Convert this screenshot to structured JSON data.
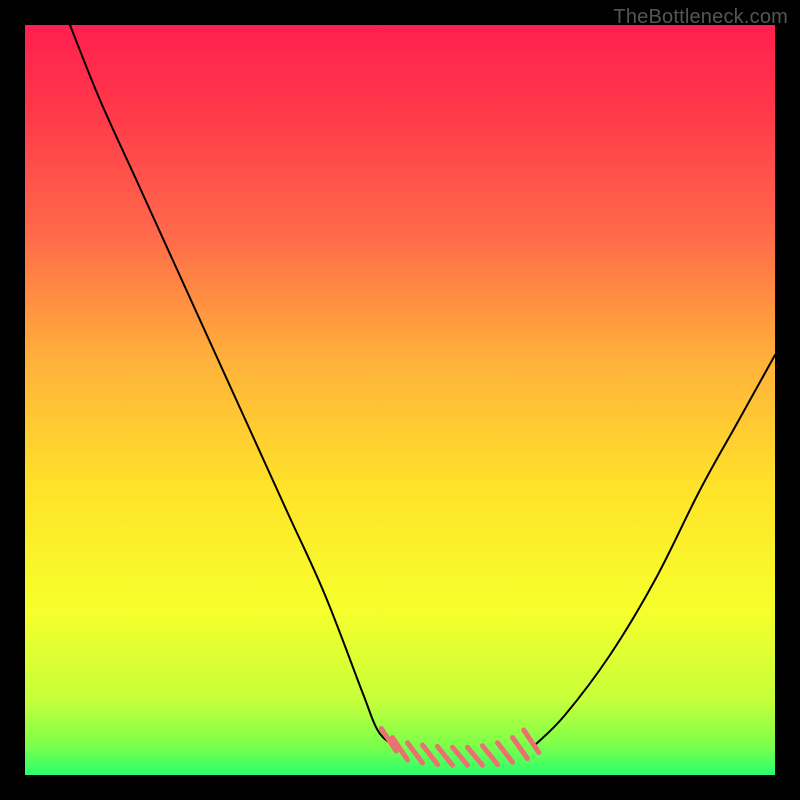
{
  "watermark": "TheBottleneck.com",
  "chart_data": {
    "type": "line",
    "title": "",
    "xlabel": "",
    "ylabel": "",
    "xlim": [
      0,
      100
    ],
    "ylim": [
      0,
      100
    ],
    "grid": false,
    "legend": false,
    "background_gradient": {
      "stops": [
        {
          "offset": 0.0,
          "color": "#ff1f4f"
        },
        {
          "offset": 0.12,
          "color": "#ff3a4a"
        },
        {
          "offset": 0.28,
          "color": "#ff6a4a"
        },
        {
          "offset": 0.45,
          "color": "#ffb23a"
        },
        {
          "offset": 0.62,
          "color": "#ffe329"
        },
        {
          "offset": 0.78,
          "color": "#f6ff2b"
        },
        {
          "offset": 0.9,
          "color": "#c6ff3a"
        },
        {
          "offset": 0.96,
          "color": "#7dff4a"
        },
        {
          "offset": 1.0,
          "color": "#2bff6e"
        }
      ]
    },
    "series": [
      {
        "name": "left-branch",
        "stroke": "#000000",
        "stroke_width": 2,
        "x": [
          6,
          10,
          15,
          20,
          25,
          30,
          35,
          40,
          45,
          47,
          49
        ],
        "y": [
          100,
          90,
          79,
          68,
          57,
          46,
          35,
          24,
          11,
          6,
          4
        ]
      },
      {
        "name": "right-branch",
        "stroke": "#000000",
        "stroke_width": 2,
        "x": [
          68,
          72,
          78,
          84,
          90,
          95,
          100
        ],
        "y": [
          4,
          8,
          16,
          26,
          38,
          47,
          56
        ]
      },
      {
        "name": "valley-hatch",
        "stroke": "#eb7070",
        "stroke_width": 5,
        "segments": [
          {
            "x": [
              47.5,
              49.5
            ],
            "y": [
              6.2,
              3.2
            ]
          },
          {
            "x": [
              49.0,
              51.0
            ],
            "y": [
              5.0,
              2.0
            ]
          },
          {
            "x": [
              51.0,
              53.0
            ],
            "y": [
              4.3,
              1.6
            ]
          },
          {
            "x": [
              53.0,
              55.0
            ],
            "y": [
              4.0,
              1.4
            ]
          },
          {
            "x": [
              55.0,
              57.0
            ],
            "y": [
              3.8,
              1.3
            ]
          },
          {
            "x": [
              57.0,
              59.0
            ],
            "y": [
              3.7,
              1.3
            ]
          },
          {
            "x": [
              59.0,
              61.0
            ],
            "y": [
              3.7,
              1.3
            ]
          },
          {
            "x": [
              61.0,
              63.0
            ],
            "y": [
              3.9,
              1.4
            ]
          },
          {
            "x": [
              63.0,
              65.0
            ],
            "y": [
              4.3,
              1.7
            ]
          },
          {
            "x": [
              65.0,
              67.0
            ],
            "y": [
              5.0,
              2.2
            ]
          },
          {
            "x": [
              66.5,
              68.5
            ],
            "y": [
              6.0,
              3.0
            ]
          }
        ]
      }
    ],
    "annotations": []
  }
}
